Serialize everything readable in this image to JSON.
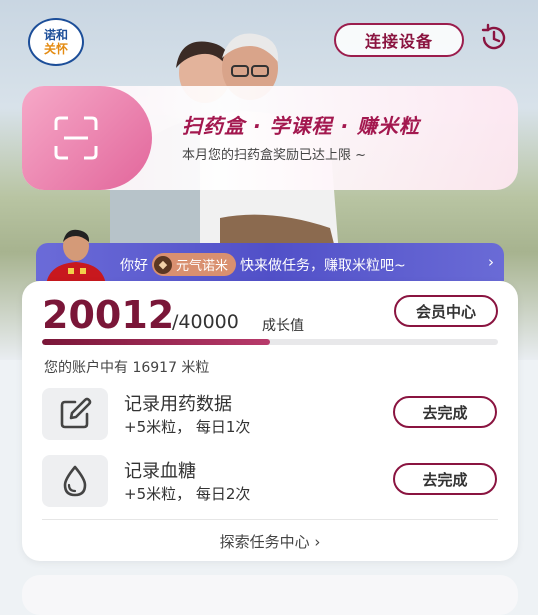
{
  "header": {
    "logo_line1": "诺和",
    "logo_line2": "关怀",
    "connect_button": "连接设备",
    "history_icon": "history-clock-icon"
  },
  "banner": {
    "icon": "scan-icon",
    "title": "扫药盒 · 学课程 · 赚米粒",
    "subtitle": "本月您的扫药盒奖励已达上限 ~"
  },
  "greeting": {
    "prefix": "你好",
    "badge_label": "元气诺米",
    "suffix": "快来做任务，赚取米粒吧~",
    "chevron": "›"
  },
  "growth": {
    "current": "20012",
    "total": "/40000",
    "unit": "成长值",
    "progress_fraction": 0.5,
    "member_button": "会员中心"
  },
  "account": {
    "text": "您的账户中有 16917 米粒"
  },
  "tasks": [
    {
      "icon": "edit-pen-icon",
      "name": "记录用药数据",
      "reward": "+5米粒， 每日1次",
      "button": "去完成"
    },
    {
      "icon": "blood-drop-icon",
      "name": "记录血糖",
      "reward": "+5米粒， 每日2次",
      "button": "去完成"
    }
  ],
  "explore_link": "探索任务中心 ›",
  "colors": {
    "brand": "#8a1440",
    "banner_accent": "#e2669b",
    "greeting_bg": "#5150c8"
  }
}
